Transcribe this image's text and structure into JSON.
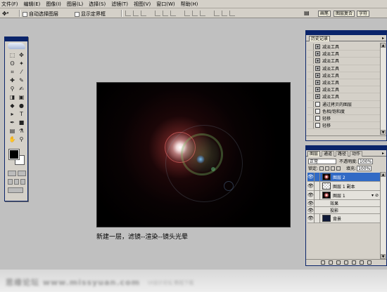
{
  "menu": [
    "文件(F)",
    "编辑(E)",
    "图像(I)",
    "图层(L)",
    "选择(S)",
    "滤镜(T)",
    "视图(V)",
    "窗口(W)",
    "帮助(H)"
  ],
  "options": {
    "auto_select_label": "自动选择图层",
    "show_bounds_label": "显示定界框",
    "well_tabs": [
      "画笔",
      "图层复合",
      "字符"
    ]
  },
  "history": {
    "tab_label": "历史记录",
    "items": [
      {
        "label": "减淡工具",
        "icon": "brush"
      },
      {
        "label": "减淡工具",
        "icon": "brush"
      },
      {
        "label": "减淡工具",
        "icon": "brush"
      },
      {
        "label": "减淡工具",
        "icon": "brush"
      },
      {
        "label": "减淡工具",
        "icon": "brush"
      },
      {
        "label": "减淡工具",
        "icon": "brush"
      },
      {
        "label": "减淡工具",
        "icon": "brush"
      },
      {
        "label": "减淡工具",
        "icon": "brush"
      },
      {
        "label": "通过拷贝的图层",
        "icon": "doc"
      },
      {
        "label": "色相/饱和度",
        "icon": "doc"
      },
      {
        "label": "轻移",
        "icon": "doc"
      },
      {
        "label": "轻移",
        "icon": "doc"
      }
    ]
  },
  "layers": {
    "tabs": [
      "图层",
      "通道",
      "路径",
      "动作"
    ],
    "blend_mode": "正常",
    "opacity_label": "不透明度:",
    "opacity_value": "100%",
    "lock_label": "锁定:",
    "fill_label": "填充:",
    "fill_value": "100%",
    "items": [
      {
        "name": "图层 2",
        "thumb": "flare",
        "selected": true,
        "fx": ""
      },
      {
        "name": "图层 1 副本",
        "thumb": "checker",
        "selected": false,
        "fx": ""
      },
      {
        "name": "图层 1",
        "thumb": "flare",
        "selected": false,
        "fx": "▾ ⊘"
      },
      {
        "name": "效果",
        "thumb": "",
        "selected": false,
        "fx": "",
        "sub": true
      },
      {
        "name": "投影",
        "thumb": "",
        "selected": false,
        "fx": "",
        "sub": true
      },
      {
        "name": "背景",
        "thumb": "blue",
        "selected": false,
        "fx": ""
      }
    ]
  },
  "caption": "新建一层，滤镜--渲染--镜头光晕",
  "watermark": {
    "main": "思缘论坛 www.missyuan.com",
    "sub": "UI设计论坛 教程下载"
  },
  "colors": {
    "foreground": "#000000",
    "background": "#ffffff",
    "panel_title": "#0a246a",
    "selection": "#316ac5"
  }
}
